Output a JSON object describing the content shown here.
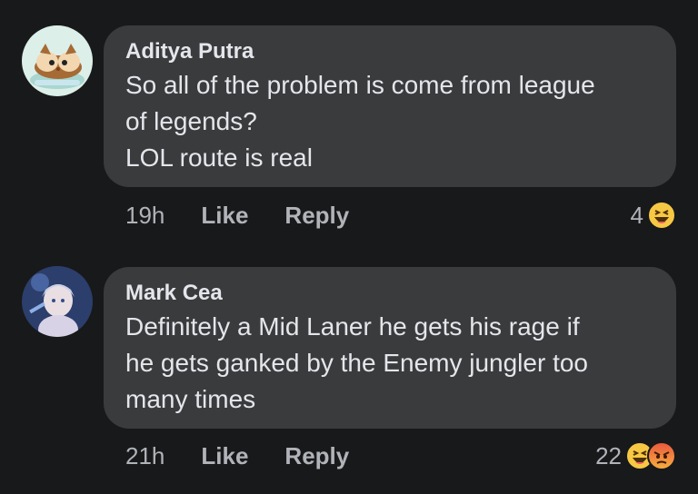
{
  "comments": [
    {
      "author": "Aditya Putra",
      "lines": [
        "So all of the problem is come from league",
        "of legends?",
        "LOL route is real"
      ],
      "time": "19h",
      "like_label": "Like",
      "reply_label": "Reply",
      "reaction_count": "4",
      "reactions": [
        "haha-emoji-icon"
      ]
    },
    {
      "author": "Mark Cea",
      "lines": [
        "Definitely a Mid Laner he gets his rage if",
        "he gets ganked by the Enemy jungler too",
        "many times"
      ],
      "time": "21h",
      "like_label": "Like",
      "reply_label": "Reply",
      "reaction_count": "22",
      "reactions": [
        "haha-emoji-icon",
        "angry-emoji-icon"
      ]
    }
  ]
}
